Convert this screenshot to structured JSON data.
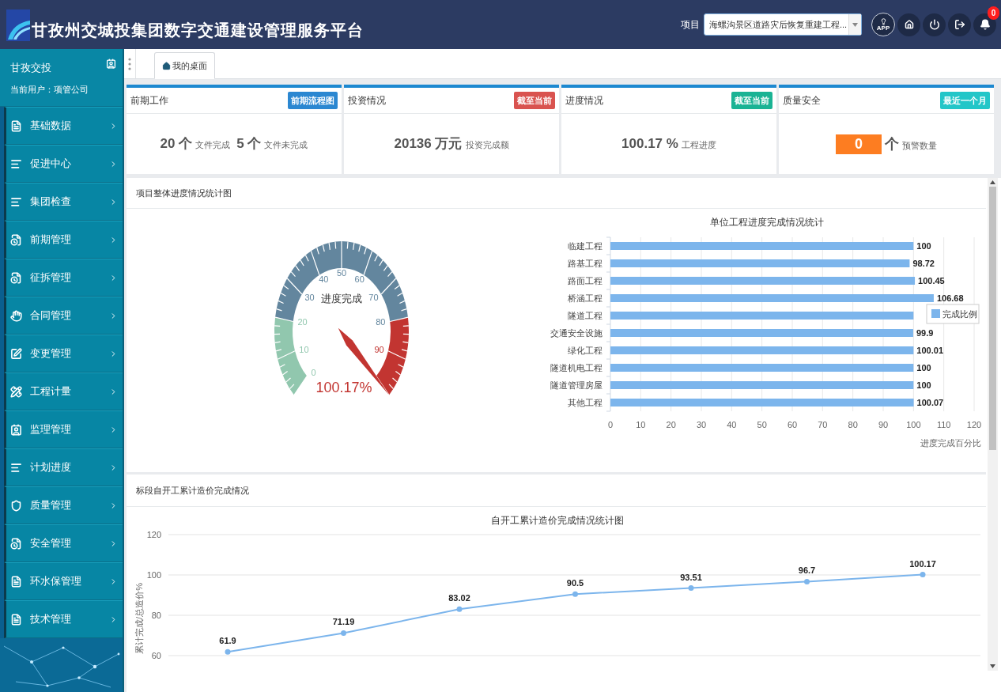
{
  "header": {
    "title": "甘孜州交城投集团数字交通建设管理服务平台",
    "project_label": "项目",
    "project_select": {
      "value": "海螺沟景区道路灾后恢复重建工程..."
    },
    "app_label": "APP",
    "notification_count": "0"
  },
  "sidebar": {
    "org_name": "甘孜交投",
    "current_user": "当前用户：项管公司",
    "items": [
      {
        "label": "基础数据"
      },
      {
        "label": "促进中心"
      },
      {
        "label": "集团检查"
      },
      {
        "label": "前期管理"
      },
      {
        "label": "征拆管理"
      },
      {
        "label": "合同管理"
      },
      {
        "label": "变更管理"
      },
      {
        "label": "工程计量"
      },
      {
        "label": "监理管理"
      },
      {
        "label": "计划进度"
      },
      {
        "label": "质量管理"
      },
      {
        "label": "安全管理"
      },
      {
        "label": "环水保管理"
      },
      {
        "label": "技术管理"
      }
    ]
  },
  "tabs": [
    {
      "label": "我的桌面",
      "selected": true
    }
  ],
  "cards": [
    {
      "title": "前期工作",
      "button": {
        "label": "前期流程图",
        "color": "#2b87d1"
      },
      "stats": [
        {
          "kind": "count",
          "value": "20 个",
          "caption": "文件完成"
        },
        {
          "kind": "count",
          "value": "5 个",
          "caption": "文件未完成"
        }
      ]
    },
    {
      "title": "投资情况",
      "button": {
        "label": "截至当前",
        "color": "#d9534f"
      },
      "stats": [
        {
          "kind": "count",
          "value": "20136 万元",
          "caption": "投资完成额"
        }
      ]
    },
    {
      "title": "进度情况",
      "button": {
        "label": "截至当前",
        "color": "#1ab394"
      },
      "stats": [
        {
          "kind": "count",
          "value": "100.17 %",
          "caption": "工程进度"
        }
      ]
    },
    {
      "title": "质量安全",
      "button": {
        "label": "最近一个月",
        "color": "#23c6c8"
      },
      "stats": [
        {
          "kind": "alert",
          "value": "0",
          "unit": "个",
          "caption": "预警数量"
        }
      ]
    }
  ],
  "progress_panel": {
    "title": "项目整体进度情况统计图",
    "gauge": {
      "title": "进度完成",
      "value_text": "100.17%",
      "axis_labels": [
        "0",
        "10",
        "20",
        "30",
        "40",
        "50",
        "60",
        "70",
        "80",
        "90"
      ]
    },
    "bar_chart": {
      "chart_data": {
        "type": "bar",
        "orientation": "horizontal",
        "title": "单位工程进度完成情况统计",
        "xlabel": "进度完成百分比",
        "categories": [
          "临建工程",
          "路基工程",
          "路面工程",
          "桥涵工程",
          "隧道工程",
          "交通安全设施",
          "绿化工程",
          "隧道机电工程",
          "隧道管理房屋",
          "其他工程"
        ],
        "series": [
          {
            "name": "完成比例",
            "color": "#7cb5ec",
            "values": [
              100,
              98.72,
              100.45,
              106.68,
              100,
              99.9,
              100.01,
              100,
              100,
              100.07
            ]
          }
        ],
        "xlim": [
          0,
          120
        ],
        "xticks": [
          0,
          10,
          20,
          30,
          40,
          50,
          60,
          70,
          80,
          90,
          100,
          110,
          120
        ],
        "grid": true,
        "value_labels": [
          "100",
          "98.72",
          "100.45",
          "106.68",
          null,
          "99.9",
          "100.01",
          "100",
          "100",
          "100.07"
        ]
      }
    }
  },
  "cost_panel": {
    "title": "标段自开工累计造价完成情况",
    "chart_data": {
      "type": "line",
      "title": "自开工累计造价完成情况统计图",
      "ylabel": "累计完成/总造价%",
      "ylim": [
        60,
        120
      ],
      "yticks": [
        60,
        80,
        100,
        120
      ],
      "grid": true,
      "series": [
        {
          "color": "#7cb5ec",
          "marker": "circle",
          "values": [
            61.9,
            71.19,
            83.02,
            90.5,
            93.51,
            96.7,
            100.17
          ]
        }
      ],
      "data_labels": true
    }
  }
}
